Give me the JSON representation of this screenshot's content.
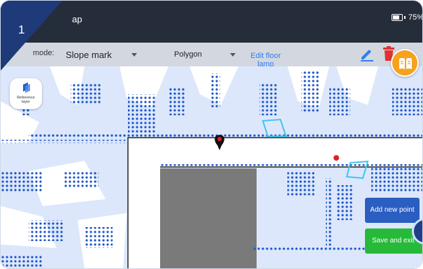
{
  "step_number": "1",
  "appbar": {
    "title": "ap",
    "battery": "75%"
  },
  "toolbar": {
    "mode_label": "mode:",
    "mode_value": "Slope mark",
    "shape_value": "Polygon",
    "edit_floor_label": "Edit floor\nlamp"
  },
  "map": {
    "reference_layer_label": "Reference\nlayer",
    "add_point_label": "Add new point",
    "save_exit_label": "Save and exit"
  },
  "colors": {
    "appbar": "#262d3a",
    "toolbar": "#d3d8e0",
    "step_badge": "#1e3a78",
    "scan_points": "#1b54c9",
    "free_space": "#dce7fb",
    "obstacle": "#7a7a7a",
    "highlight_polygon": "#3ec6ee",
    "marker": "#e0202a",
    "add_button": "#2a5ec1",
    "save_button": "#27b93a",
    "badge": "#f6a21e",
    "edit_link": "#2f7ef0"
  },
  "icons": [
    "battery-icon",
    "pencil-icon",
    "trash-icon",
    "book-icon",
    "reference-layer-icon",
    "map-pin-icon",
    "location-dot-icon"
  ]
}
